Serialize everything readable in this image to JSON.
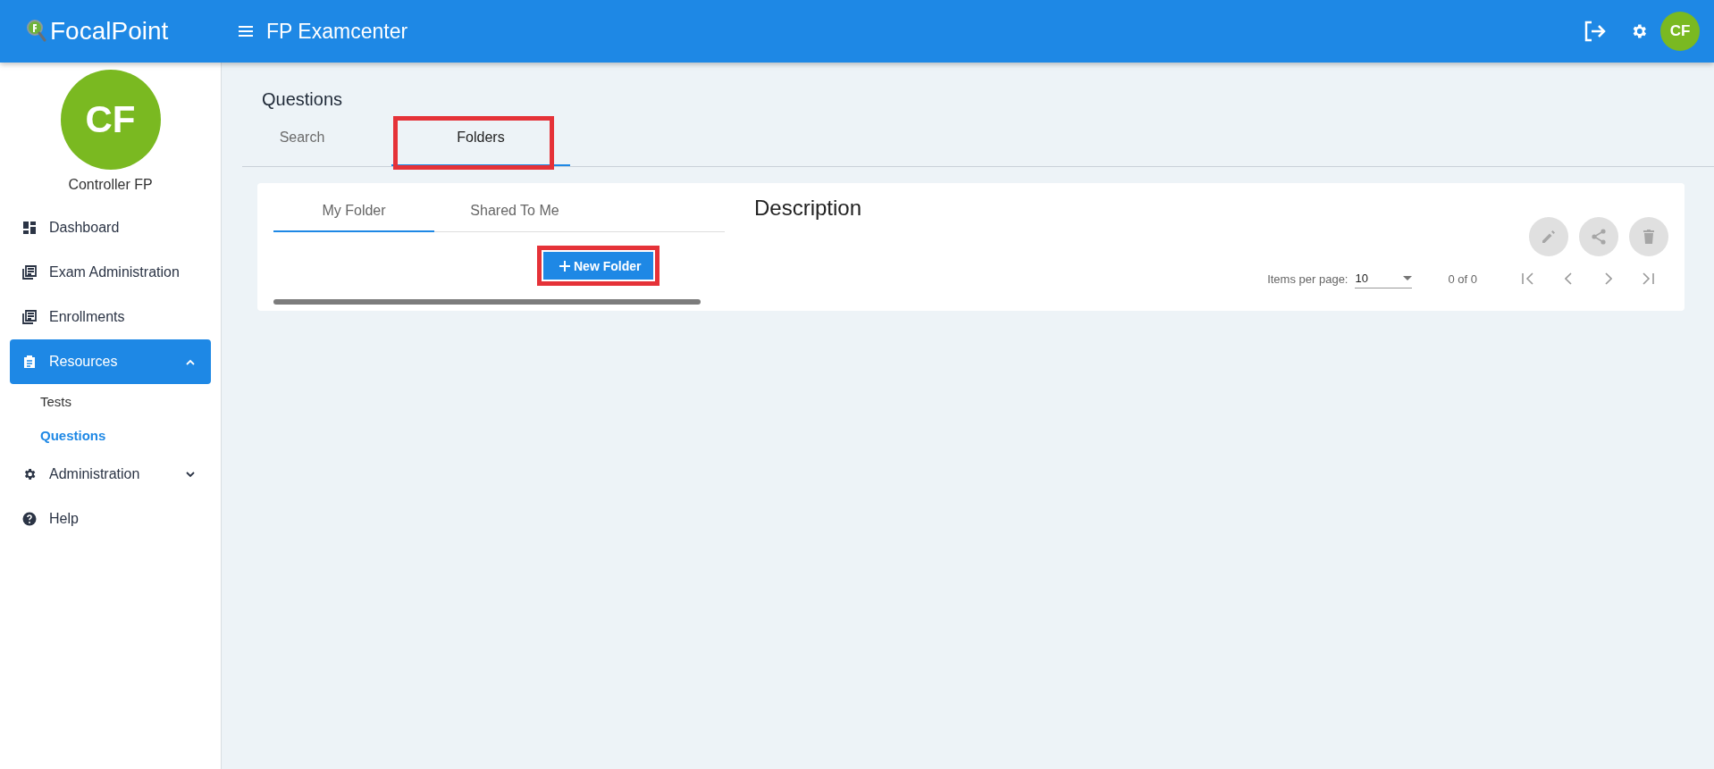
{
  "header": {
    "logo_text": "FocalPoint",
    "app_title": "FP Examcenter",
    "avatar_initials": "CF"
  },
  "sidebar": {
    "avatar_initials": "CF",
    "user_name": "Controller FP",
    "items": [
      {
        "label": "Dashboard",
        "kind": "item",
        "selected": false
      },
      {
        "label": "Exam Administration",
        "kind": "item",
        "selected": false
      },
      {
        "label": "Enrollments",
        "kind": "item",
        "selected": false
      },
      {
        "label": "Resources",
        "kind": "group",
        "selected": true,
        "expanded": true,
        "children": [
          {
            "label": "Tests",
            "selected": false
          },
          {
            "label": "Questions",
            "selected": true
          }
        ]
      },
      {
        "label": "Administration",
        "kind": "group",
        "selected": false,
        "expanded": false
      },
      {
        "label": "Help",
        "kind": "item",
        "selected": false
      }
    ]
  },
  "page": {
    "title": "Questions",
    "tabs": [
      {
        "label": "Search",
        "selected": false,
        "highlighted": false
      },
      {
        "label": "Folders",
        "selected": true,
        "highlighted": true
      }
    ]
  },
  "folders": {
    "tabs": [
      {
        "label": "My Folder",
        "selected": true
      },
      {
        "label": "Shared To Me",
        "selected": false
      }
    ],
    "new_button": {
      "label": "New Folder",
      "highlighted": true
    }
  },
  "details": {
    "title": "Description",
    "actions_disabled": true,
    "paginator": {
      "items_per_page_label": "Items per page:",
      "page_size": "10",
      "range": "0 of 0"
    }
  }
}
